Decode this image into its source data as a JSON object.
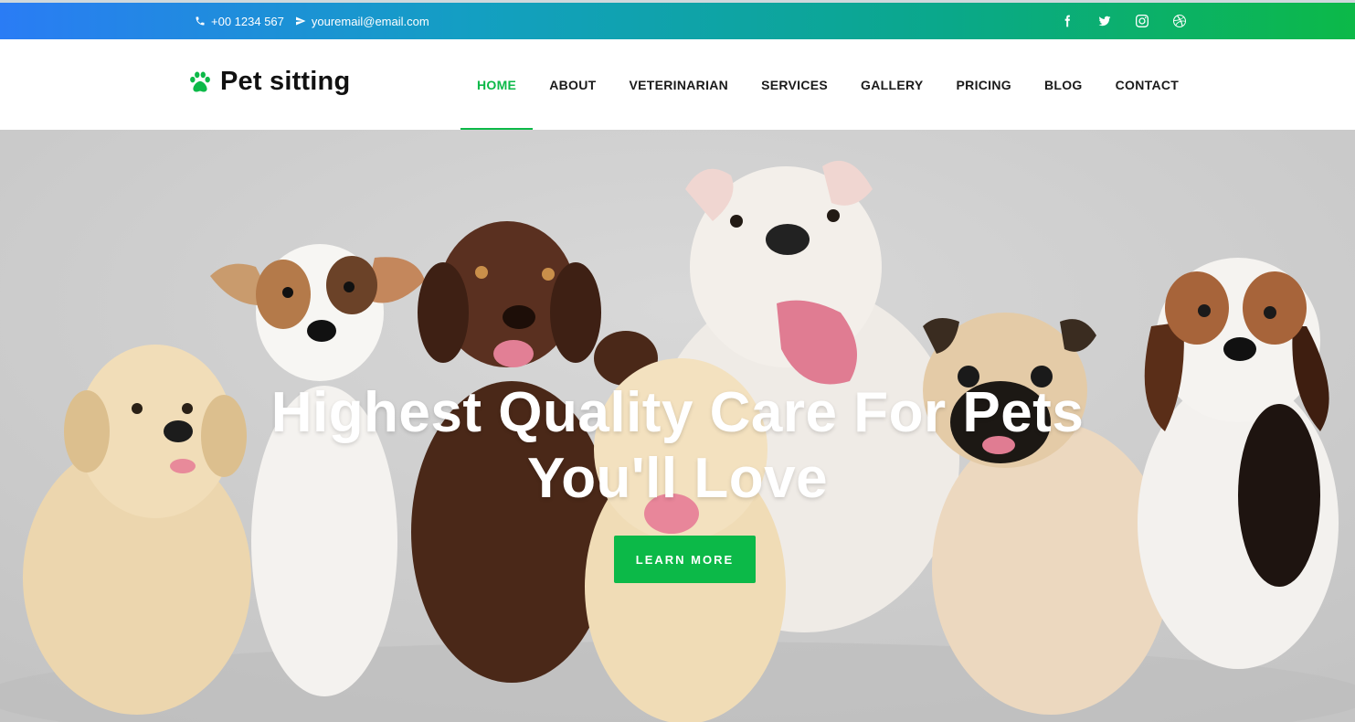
{
  "topbar": {
    "phone": "+00 1234 567",
    "email": "youremail@email.com",
    "social": [
      "facebook-icon",
      "twitter-icon",
      "instagram-icon",
      "dribbble-icon"
    ]
  },
  "header": {
    "brand": "Pet sitting",
    "nav": [
      "HOME",
      "ABOUT",
      "VETERINARIAN",
      "SERVICES",
      "GALLERY",
      "PRICING",
      "BLOG",
      "CONTACT"
    ],
    "active_nav": "HOME"
  },
  "hero": {
    "title_line1": "Highest Quality Care For Pets",
    "title_line2": "You'll Love",
    "button": "LEARN MORE"
  },
  "colors": {
    "accent": "#0cb948",
    "topbar_start": "#2a7cf5",
    "topbar_end": "#0cb948",
    "hero_bg": "#cfcfcf"
  }
}
